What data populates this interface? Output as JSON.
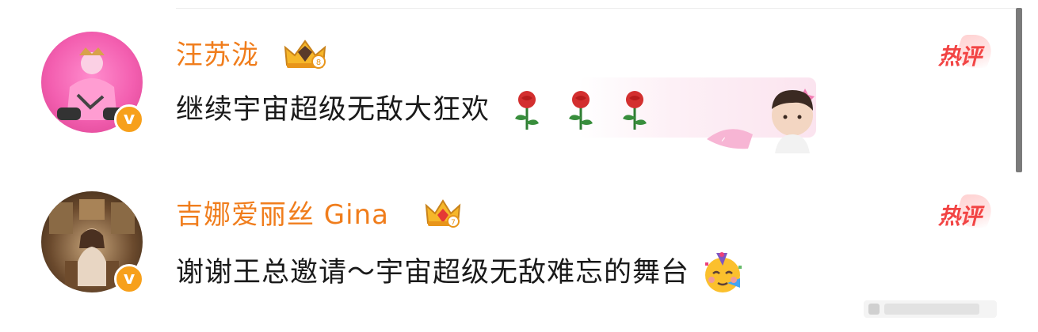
{
  "comments": [
    {
      "username": "汪苏泷",
      "text": "继续宇宙超级无敌大狂欢",
      "badge": "热评",
      "verified_mark": "v",
      "crown_icon": "crown-icon",
      "trailing_icons": [
        "rose-icon",
        "rose-icon",
        "rose-icon"
      ],
      "sticker": "avatar-sticker"
    },
    {
      "username": "吉娜爱丽丝 Gina",
      "text": "谢谢王总邀请～宇宙超级无敌难忘的舞台",
      "badge": "热评",
      "verified_mark": "v",
      "crown_icon": "crown-icon",
      "trailing_icons": [
        "party-face-emoji"
      ]
    }
  ],
  "colors": {
    "username": "#f07d1c",
    "hot_badge": "#f24444",
    "verified": "#f7a01b",
    "text": "#1a1a1a"
  }
}
